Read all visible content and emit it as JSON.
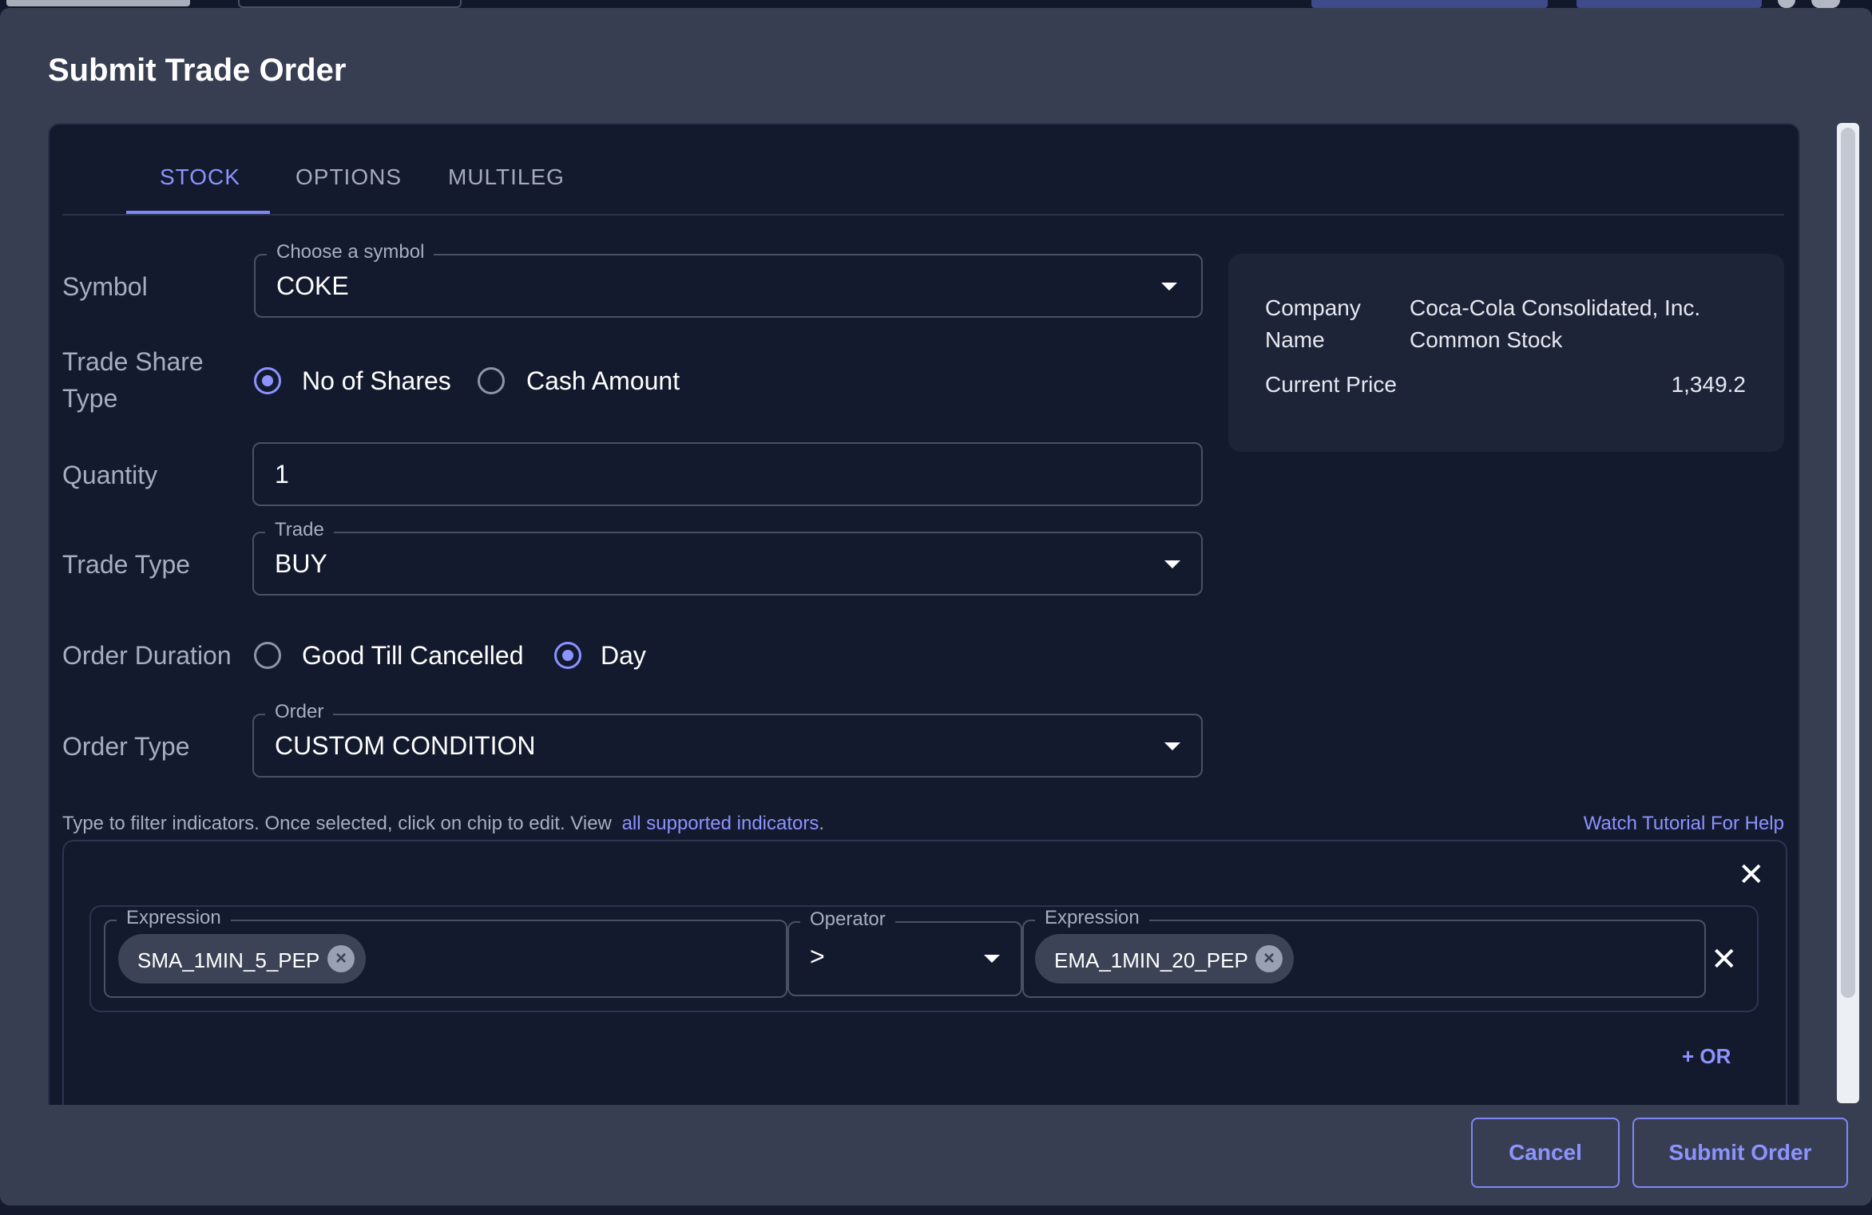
{
  "modal": {
    "title": "Submit Trade Order"
  },
  "tabs": [
    {
      "label": "STOCK",
      "active": true
    },
    {
      "label": "OPTIONS",
      "active": false
    },
    {
      "label": "MULTILEG",
      "active": false
    }
  ],
  "form": {
    "symbol": {
      "label": "Symbol",
      "legend": "Choose a symbol",
      "value": "COKE"
    },
    "trade_share_type": {
      "label_line1": "Trade Share",
      "label_line2": "Type",
      "options": [
        {
          "label": "No of Shares",
          "selected": true
        },
        {
          "label": "Cash Amount",
          "selected": false
        }
      ]
    },
    "quantity": {
      "label": "Quantity",
      "value": "1"
    },
    "trade_type": {
      "label": "Trade Type",
      "legend": "Trade",
      "value": "BUY"
    },
    "order_duration": {
      "label": "Order Duration",
      "options": [
        {
          "label": "Good Till Cancelled",
          "selected": false
        },
        {
          "label": "Day",
          "selected": true
        }
      ]
    },
    "order_type": {
      "label": "Order Type",
      "legend": "Order",
      "value": "CUSTOM CONDITION"
    }
  },
  "info": {
    "company_name_label_1": "Company",
    "company_name_label_2": "Name",
    "company_name_1": "Coca-Cola Consolidated, Inc.",
    "company_name_2": "Common Stock",
    "current_price_label": "Current Price",
    "current_price": "1,349.2"
  },
  "hint": {
    "text": "Type to filter indicators. Once selected, click on chip to edit. View",
    "link": "all supported indicators",
    "suffix": ".",
    "tutorial": "Watch Tutorial For Help"
  },
  "condition": {
    "left": {
      "legend": "Expression",
      "chip": "SMA_1MIN_5_PEP"
    },
    "operator": {
      "legend": "Operator",
      "value": ">"
    },
    "right": {
      "legend": "Expression",
      "chip": "EMA_1MIN_20_PEP"
    },
    "or_label": "+ OR"
  },
  "footer": {
    "cancel": "Cancel",
    "submit": "Submit Order"
  },
  "colors": {
    "accent": "#8c93ff",
    "panel": "#141a2e",
    "modal": "#383e52"
  }
}
